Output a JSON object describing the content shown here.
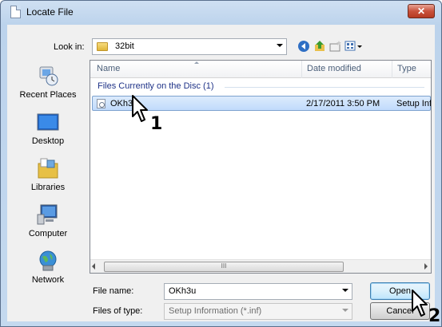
{
  "window": {
    "title": "Locate File",
    "close_glyph": "✕"
  },
  "lookin": {
    "label": "Look in:",
    "value": "32bit"
  },
  "toolbar": {
    "back_icon": "back-icon",
    "up_icon": "up-folder-icon",
    "new_folder_icon": "new-folder-icon",
    "views_icon": "views-icon"
  },
  "places": [
    {
      "label": "Recent Places",
      "icon": "recent-places-icon"
    },
    {
      "label": "Desktop",
      "icon": "desktop-icon"
    },
    {
      "label": "Libraries",
      "icon": "libraries-icon"
    },
    {
      "label": "Computer",
      "icon": "computer-icon"
    },
    {
      "label": "Network",
      "icon": "network-icon"
    }
  ],
  "filelist": {
    "columns": [
      "Name",
      "Date modified",
      "Type"
    ],
    "group": "Files Currently on the Disc (1)",
    "rows": [
      {
        "name": "OKh3u",
        "date": "2/17/2011 3:50 PM",
        "type": "Setup Info"
      }
    ],
    "scroll_grip": "III"
  },
  "file_name": {
    "label": "File name:",
    "value": "OKh3u"
  },
  "file_type": {
    "label": "Files of type:",
    "value": "Setup Information (*.inf)"
  },
  "buttons": {
    "open": "Open",
    "cancel": "Cancel"
  },
  "callouts": {
    "step1": "1",
    "step2": "2"
  }
}
